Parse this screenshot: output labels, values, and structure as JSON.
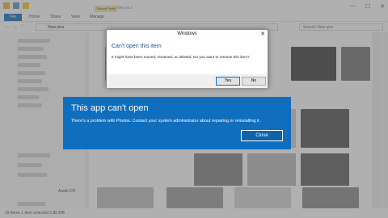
{
  "explorer": {
    "context_tab": "Picture Tools",
    "window_title": "New pics",
    "caption": {
      "minimize": "—",
      "maximize": "☐",
      "close": "✕"
    },
    "ribbon_tabs": {
      "file": "File",
      "home": "Home",
      "share": "Share",
      "view": "View",
      "manage": "Manage"
    },
    "address": "New pics",
    "search_placeholder": "Search New pics",
    "sidebar_label": "Audio CD",
    "status": "29 items    1 item selected  5.80 MB"
  },
  "dialog": {
    "caption": "Windows",
    "close": "✕",
    "heading": "Can't open this item",
    "message": "It might have been moved, renamed, or deleted. Do you want to remove this item?",
    "yes_label": "Yes",
    "no_label": "No"
  },
  "banner": {
    "title": "This app can't open",
    "message": "There's a problem with Photos. Contact your system administrator about repairing or reinstalling it.",
    "close_label": "Close",
    "accent": "#106ebe"
  }
}
